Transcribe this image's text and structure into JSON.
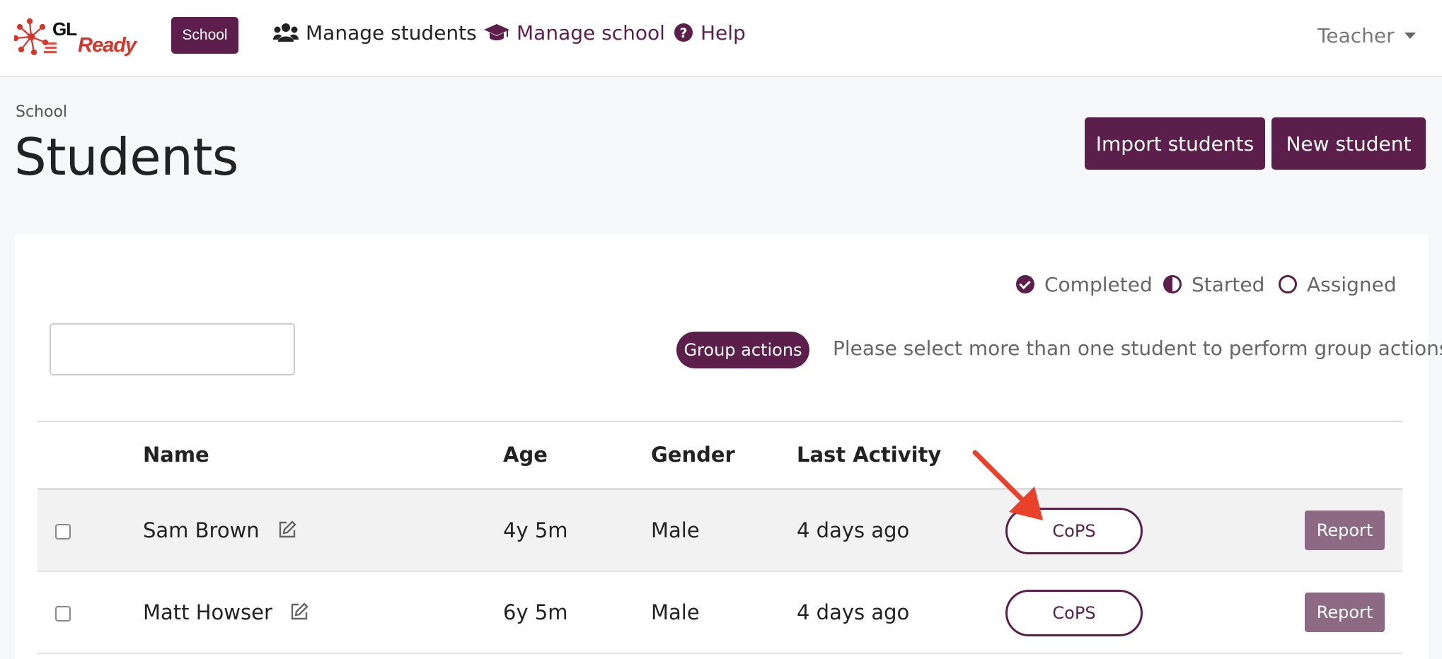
{
  "navbar": {
    "logo_top": "GL",
    "logo_bottom": "Ready",
    "badge": "School",
    "links": [
      {
        "label": "Manage students",
        "icon": "users-icon"
      },
      {
        "label": "Manage school",
        "icon": "graduation-cap-icon"
      },
      {
        "label": "Help",
        "icon": "question-circle-icon"
      }
    ],
    "user_menu": "Teacher"
  },
  "header": {
    "breadcrumb": "School",
    "title": "Students",
    "import_button": "Import students",
    "new_button": "New student"
  },
  "legend": [
    {
      "label": "Completed",
      "icon": "check-circle-icon"
    },
    {
      "label": "Started",
      "icon": "half-circle-icon"
    },
    {
      "label": "Assigned",
      "icon": "empty-circle-icon"
    }
  ],
  "toolbar": {
    "search_value": "",
    "group_actions_label": "Group actions",
    "group_actions_hint": "Please select more than one student to perform group actions"
  },
  "table": {
    "columns": [
      "Name",
      "Age",
      "Gender",
      "Last Activity"
    ],
    "rows": [
      {
        "name": "Sam Brown",
        "age": "4y 5m",
        "gender": "Male",
        "last_activity": "4 days ago",
        "assessment": "CoPS",
        "report": "Report"
      },
      {
        "name": "Matt Howser",
        "age": "6y 5m",
        "gender": "Male",
        "last_activity": "4 days ago",
        "assessment": "CoPS",
        "report": "Report"
      }
    ]
  },
  "colors": {
    "brand": "#5c1f4c",
    "report_button": "#8d6a84",
    "annotation_arrow": "#e8432a",
    "logo_red": "#d7342a"
  }
}
